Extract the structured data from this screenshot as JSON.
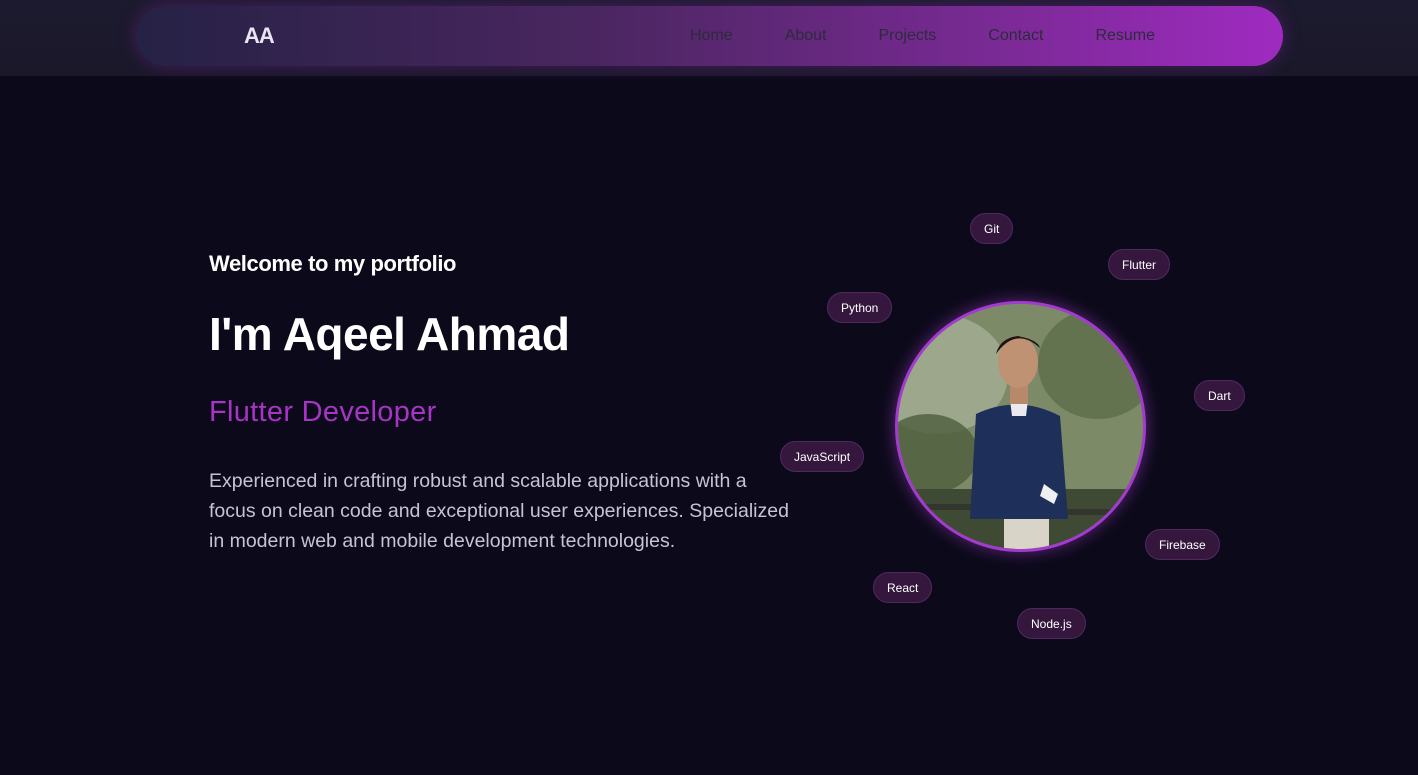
{
  "nav": {
    "logo": "AA",
    "links": [
      "Home",
      "About",
      "Projects",
      "Contact",
      "Resume"
    ]
  },
  "hero": {
    "welcome": "Welcome to my portfolio",
    "name": "I'm Aqeel Ahmad",
    "role": "Flutter Developer",
    "bio": "Experienced in crafting robust and scalable applications with a focus on clean code and exceptional user experiences. Specialized in modern web and mobile development technologies."
  },
  "skills": [
    "Git",
    "Flutter",
    "Python",
    "Dart",
    "JavaScript",
    "Firebase",
    "React",
    "Node.js"
  ],
  "colors": {
    "background": "#0c0a1a",
    "accent": "#a634c4",
    "chip": "#35173e"
  }
}
